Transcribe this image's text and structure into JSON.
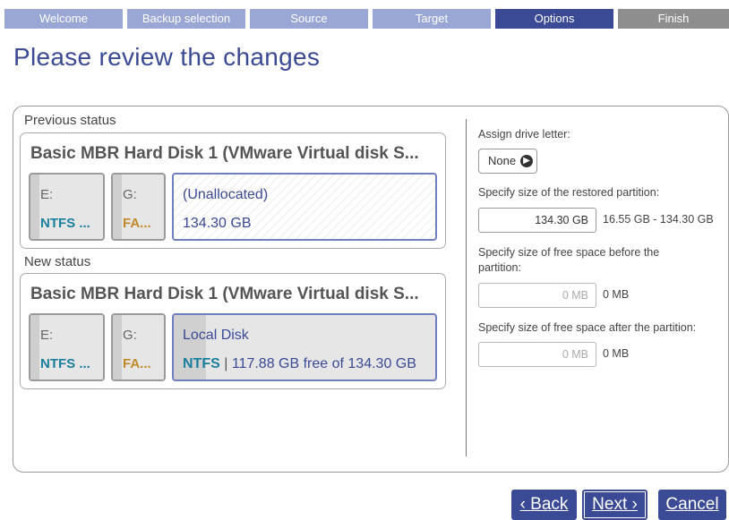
{
  "steps": [
    {
      "label": "Welcome",
      "state": "done"
    },
    {
      "label": "Backup selection",
      "state": "done"
    },
    {
      "label": "Source",
      "state": "done"
    },
    {
      "label": "Target",
      "state": "done"
    },
    {
      "label": "Options",
      "state": "active"
    },
    {
      "label": "Finish",
      "state": "pending"
    }
  ],
  "title": "Please review the changes",
  "previous": {
    "label": "Previous status",
    "disk_title": "Basic MBR Hard Disk 1 (VMware Virtual disk S...",
    "partitions": [
      {
        "letter": "E:",
        "fs": "NTFS ..."
      },
      {
        "letter": "G:",
        "fs": "FA..."
      }
    ],
    "unallocated": {
      "name": "(Unallocated)",
      "size": "134.30 GB"
    }
  },
  "new": {
    "label": "New status",
    "disk_title": "Basic MBR Hard Disk 1 (VMware Virtual disk S...",
    "partitions": [
      {
        "letter": "E:",
        "fs": "NTFS ..."
      },
      {
        "letter": "G:",
        "fs": "FA..."
      }
    ],
    "target": {
      "name": "Local Disk",
      "fs": "NTFS",
      "sep": "|",
      "free": "117.88 GB free of 134.30 GB"
    }
  },
  "options": {
    "drive_letter_label": "Assign drive letter:",
    "drive_letter_value": "None",
    "size_label": "Specify size of the restored partition:",
    "size_value": "134.30 GB",
    "size_range": "16.55 GB - 134.30 GB",
    "before_label": "Specify size of free space before the partition:",
    "before_value": "0 MB",
    "before_range": "0 MB",
    "after_label": "Specify size of free space after the partition:",
    "after_value": "0 MB",
    "after_range": "0 MB"
  },
  "buttons": {
    "back": "‹ Back",
    "next": "Next ›",
    "cancel": "Cancel"
  },
  "colors": {
    "accent": "#3b4a94",
    "step_done": "#9aa6d3",
    "step_pending": "#8e8e8e",
    "ntfs": "#1a7f9c",
    "fat": "#c08a2a"
  }
}
